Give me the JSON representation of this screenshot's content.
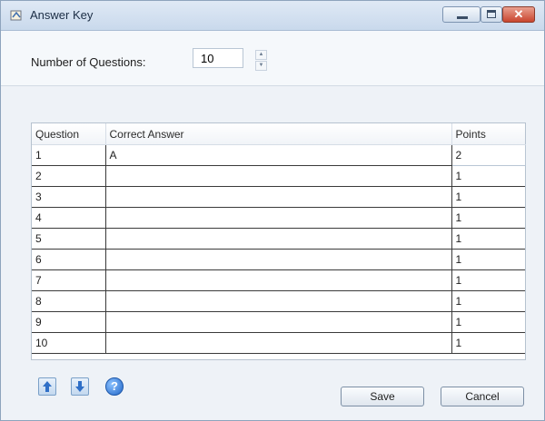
{
  "window": {
    "title": "Answer Key",
    "close_glyph": "✕"
  },
  "settings": {
    "num_questions_label": "Number of Questions:",
    "num_questions_value": "10"
  },
  "table": {
    "headers": [
      "Question",
      "Correct Answer",
      "Points"
    ],
    "rows": [
      {
        "question": "1",
        "answer": "A",
        "points": "2"
      },
      {
        "question": "2",
        "answer": "",
        "points": "1"
      },
      {
        "question": "3",
        "answer": "",
        "points": "1"
      },
      {
        "question": "4",
        "answer": "",
        "points": "1"
      },
      {
        "question": "5",
        "answer": "",
        "points": "1"
      },
      {
        "question": "6",
        "answer": "",
        "points": "1"
      },
      {
        "question": "7",
        "answer": "",
        "points": "1"
      },
      {
        "question": "8",
        "answer": "",
        "points": "1"
      },
      {
        "question": "9",
        "answer": "",
        "points": "1"
      },
      {
        "question": "10",
        "answer": "",
        "points": "1"
      }
    ]
  },
  "footer": {
    "help_glyph": "?",
    "save_label": "Save",
    "cancel_label": "Cancel",
    "icons": [
      "move-up-icon",
      "move-down-icon",
      "help-icon"
    ]
  },
  "colors": {
    "titlebar": "#c9d9ec",
    "close_button": "#c9452e",
    "help_icon": "#2166c8"
  }
}
